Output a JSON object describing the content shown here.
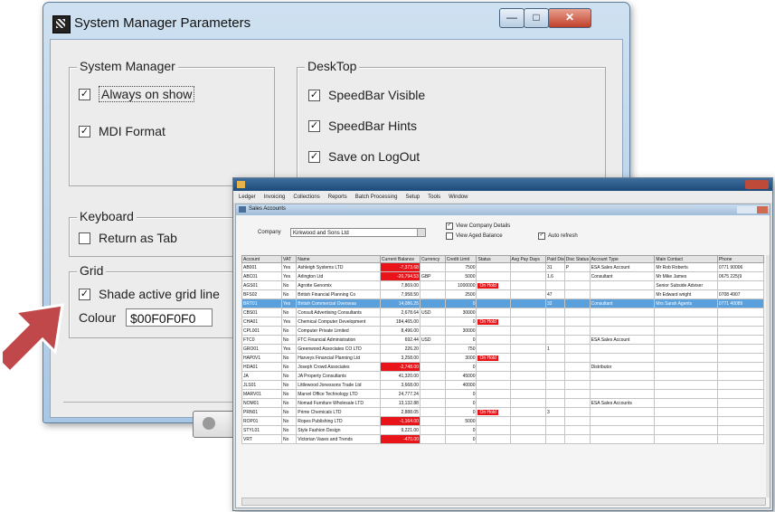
{
  "dialog": {
    "title": "System Manager Parameters",
    "system_manager": {
      "label": "System Manager",
      "always_on_show": {
        "label": "Always on show",
        "checked": true
      },
      "mdi_format": {
        "label": "MDI Format",
        "checked": true
      }
    },
    "desktop": {
      "label": "DeskTop",
      "speedbar_visible": {
        "label": "SpeedBar Visible",
        "checked": true
      },
      "speedbar_hints": {
        "label": "SpeedBar Hints",
        "checked": true
      },
      "save_on_logout": {
        "label": "Save on LogOut",
        "checked": true
      }
    },
    "keyboard": {
      "label": "Keyboard",
      "return_as_tab": {
        "label": "Return as Tab",
        "checked": false
      }
    },
    "grid": {
      "label": "Grid",
      "shade_active_grid_line": {
        "label": "Shade active grid line",
        "checked": true
      },
      "colour_label": "Colour",
      "colour_value": "$00F0F0F0"
    }
  },
  "app": {
    "menu": [
      "Ledger",
      "Invoicing",
      "Collections",
      "Reports",
      "Batch Processing",
      "Setup",
      "Tools",
      "Window"
    ],
    "inner_title": "Sales Accounts",
    "filter": {
      "company_label": "Company",
      "company_value": "Kirkwood and Sons Ltd",
      "view_company_details": {
        "label": "View Company Details",
        "checked": true
      },
      "view_aged_balance": {
        "label": "View Aged Balance",
        "checked": false
      },
      "auto_refresh": {
        "label": "Auto refresh",
        "checked": true
      }
    },
    "columns": [
      "Account",
      "VAT",
      "Name",
      "Current Balance",
      "Currency",
      "Credit Limit",
      "Status",
      "Avg Pay Days",
      "Paid Disc",
      "Disc Status",
      "Account Type",
      "Main Contact",
      "Phone"
    ],
    "rows": [
      [
        "AB001",
        "Yes",
        "Ashleigh Systems LTD",
        "-7,373.68",
        "",
        "7500",
        "",
        "",
        "31",
        "P",
        "ESA Sales Account",
        "Mr Rob Roberts",
        "0771 90006"
      ],
      [
        "ABC01",
        "Yes",
        "Arlington Ltd",
        "-20,794.53",
        "GBP",
        "5000",
        "",
        "",
        "1.6",
        "",
        "Consultant",
        "Mr Mike James",
        "0675 225(9"
      ],
      [
        "AGS01",
        "No",
        "Agrotte Genomix",
        "7,869.00",
        "",
        "1000000",
        "On Hold",
        "",
        "",
        "",
        "",
        "Senior Subside Adviser",
        ""
      ],
      [
        "BFS02",
        "No",
        "British Financial Planning Co",
        "7,958.50",
        "",
        "2500",
        "",
        "",
        "47",
        "",
        "",
        "Mr Edward wright",
        "0708 4907"
      ],
      [
        "BRT01",
        "Yes",
        "British Commercial Overseas",
        "14,086.25",
        "",
        "0",
        "",
        "",
        "32",
        "",
        "Consultant",
        "Mrs Sarah Agents",
        "0771 40089"
      ],
      [
        "CBS01",
        "No",
        "Consult Advertising Consultants",
        "2,678.64",
        "USD",
        "30000",
        "",
        "",
        "",
        "",
        "",
        "",
        ""
      ],
      [
        "CHA01",
        "Yes",
        "Chemical Computer Development",
        "184,465.00",
        "",
        "0",
        "On Hold",
        "",
        "",
        "",
        "",
        "",
        ""
      ],
      [
        "CPL001",
        "No",
        "Computer Private Limited",
        "8,496.00",
        "",
        "30000",
        "",
        "",
        "",
        "",
        "",
        "",
        ""
      ],
      [
        "FTC0",
        "No",
        "FTC Financial Administration",
        "692.44",
        "USD",
        "0",
        "",
        "",
        "",
        "",
        "ESA Sales Account",
        "",
        ""
      ],
      [
        "GRO01",
        "Yes",
        "Greenwood Associates CO LTD",
        "226.20",
        "",
        "750",
        "",
        "",
        "1",
        "",
        "",
        "",
        ""
      ],
      [
        "HAP0V1",
        "No",
        "Harveys Financial Planning Ltd",
        "3,258.00",
        "",
        "3000",
        "On Hold",
        "",
        "",
        "",
        "",
        "",
        ""
      ],
      [
        "HDA01",
        "No",
        "Joseph Crowd Associates",
        "-2,748.00",
        "",
        "0",
        "",
        "",
        "",
        "",
        "Distributor",
        "",
        ""
      ],
      [
        "JA",
        "No",
        "JA Property Consultants",
        "41,320.00",
        "",
        "45000",
        "",
        "",
        "",
        "",
        "",
        "",
        ""
      ],
      [
        "JLS01",
        "No",
        "Littlewood Jonessons Trade Ltd",
        "3,668.00",
        "",
        "40000",
        "",
        "",
        "",
        "",
        "",
        "",
        ""
      ],
      [
        "MARV01",
        "No",
        "Marvel Office Technology LTD",
        "24,777.24",
        "",
        "0",
        "",
        "",
        "",
        "",
        "",
        "",
        ""
      ],
      [
        "NOM01",
        "No",
        "Nomad Furniture Wholesale LTD",
        "13,132.88",
        "",
        "0",
        "",
        "",
        "",
        "",
        "ESA Sales Accounts",
        "",
        ""
      ],
      [
        "PRN01",
        "No",
        "Prime Chemicals LTD",
        "2,888.05",
        "",
        "0",
        "On Hold",
        "",
        "3",
        "",
        "",
        "",
        ""
      ],
      [
        "ROP01",
        "No",
        "Ropes Publishing LTD",
        "-1,164.00",
        "",
        "5000",
        "",
        "",
        "",
        "",
        "",
        "",
        ""
      ],
      [
        "STYL01",
        "No",
        "Style Fashion Design",
        "9,221.00",
        "",
        "0",
        "",
        "",
        "",
        "",
        "",
        "",
        ""
      ],
      [
        "VRT",
        "No",
        "Victorian Vases and Trends",
        "-470.00",
        "",
        "0",
        "",
        "",
        "",
        "",
        "",
        "",
        ""
      ]
    ],
    "row_marker": "►"
  },
  "colors": {
    "negative": "#e8141a",
    "selected_row": "#5aa0dd",
    "arrow": "#c0484a"
  }
}
